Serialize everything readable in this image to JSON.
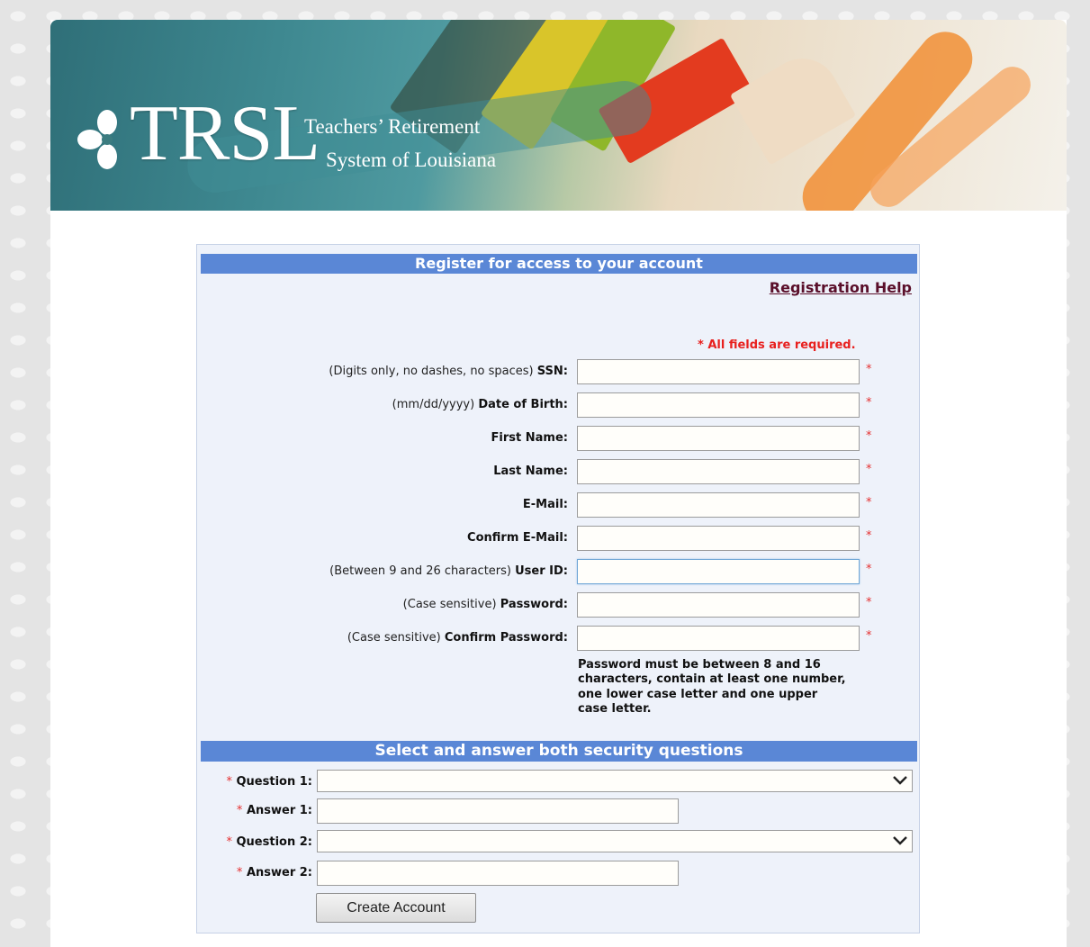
{
  "banner": {
    "logo_text": "TRSL",
    "logo_sub_line1": "Teachers’ Retirement",
    "logo_sub_line2": "System of Louisiana"
  },
  "form": {
    "title": "Register for access to your account",
    "help_link": "Registration Help",
    "required_note": "* All fields are required.",
    "fields": [
      {
        "hint": "(Digits only, no dashes, no spaces) ",
        "label": "SSN:",
        "value": ""
      },
      {
        "hint": "(mm/dd/yyyy) ",
        "label": "Date of Birth:",
        "value": ""
      },
      {
        "hint": "",
        "label": "First Name:",
        "value": ""
      },
      {
        "hint": "",
        "label": "Last Name:",
        "value": ""
      },
      {
        "hint": "",
        "label": "E-Mail:",
        "value": ""
      },
      {
        "hint": "",
        "label": "Confirm E-Mail:",
        "value": ""
      },
      {
        "hint": "(Between 9 and 26 characters) ",
        "label": "User ID:",
        "value": ""
      },
      {
        "hint": "(Case sensitive) ",
        "label": "Password:",
        "value": ""
      },
      {
        "hint": "(Case sensitive) ",
        "label": "Confirm Password:",
        "value": ""
      }
    ],
    "required_star": "*",
    "password_note": "Password must be between 8 and 16 characters, contain at least one number, one lower case letter and one upper case letter."
  },
  "security": {
    "title": "Select and answer both security questions",
    "question1_label": "Question 1:",
    "answer1_label": "Answer 1:",
    "question2_label": "Question 2:",
    "answer2_label": "Answer 2:",
    "question1_value": "",
    "question2_value": "",
    "answer1_value": "",
    "answer2_value": ""
  },
  "submit_label": "Create Account",
  "colors": {
    "header_bar": "#5a87d6",
    "required": "#e53030",
    "help_link": "#5a0f2a",
    "form_bg": "#eef2fa"
  }
}
